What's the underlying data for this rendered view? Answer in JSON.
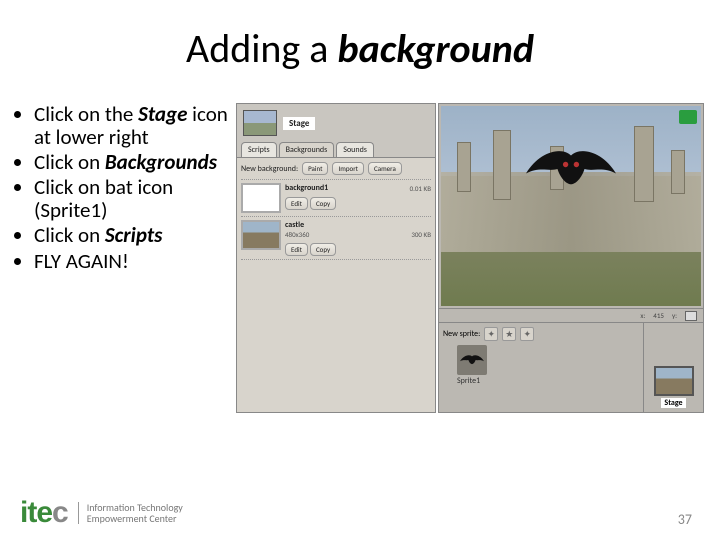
{
  "title_prefix": "Adding a ",
  "title_em": "background",
  "bullets": [
    {
      "pre": "Click on the ",
      "em": "Stage",
      "post": " icon at lower right"
    },
    {
      "pre": "Click on ",
      "em": "Backgrounds",
      "post": ""
    },
    {
      "pre": "Click on bat icon (Sprite1)",
      "em": "",
      "post": ""
    },
    {
      "pre": "Click on ",
      "em": "Scripts",
      "post": ""
    },
    {
      "pre": "FLY AGAIN!",
      "em": "",
      "post": ""
    }
  ],
  "scratch": {
    "stage_label": "Stage",
    "tabs": [
      "Scripts",
      "Backgrounds",
      "Sounds"
    ],
    "new_bg_label": "New background:",
    "new_bg_btns": [
      "Paint",
      "Import",
      "Camera"
    ],
    "bg1": {
      "name": "background1",
      "size": "0.01 KB"
    },
    "bg2": {
      "name": "castle",
      "dims": "480x360",
      "size": "300 KB"
    },
    "item_btns": [
      "Edit",
      "Copy"
    ],
    "new_sprite_label": "New sprite:",
    "sprite1": "Sprite1",
    "stage_corner": "Stage",
    "coord_x": "x:",
    "coord_xv": "415",
    "coord_y": "y:"
  },
  "logo": {
    "mark": "itec",
    "line1": "Information Technology",
    "line2": "Empowerment Center"
  },
  "page": "37"
}
